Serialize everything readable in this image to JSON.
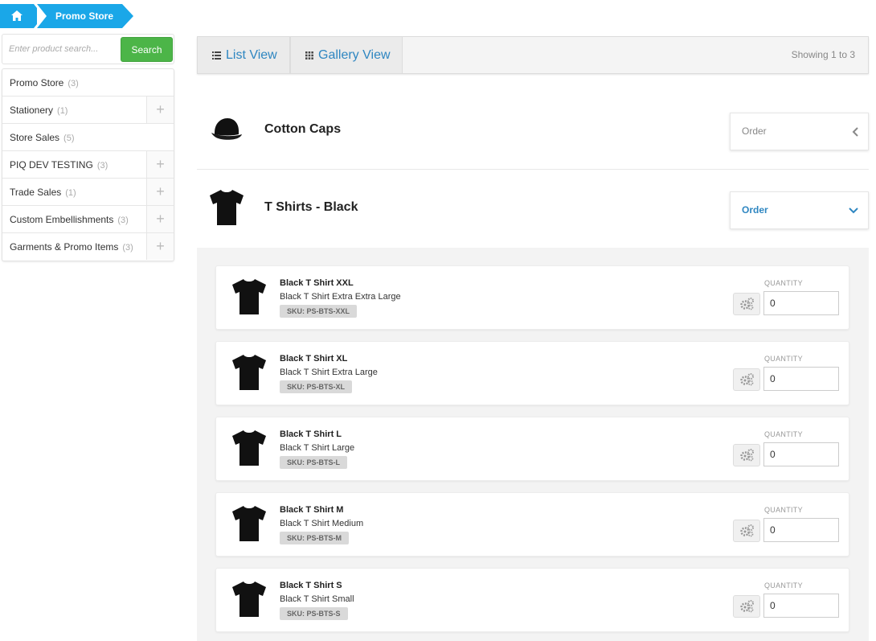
{
  "breadcrumb": {
    "current": "Promo Store"
  },
  "search": {
    "placeholder": "Enter product search...",
    "button_label": "Search"
  },
  "sidebar": {
    "items": [
      {
        "label": "Promo Store",
        "count": "(3)",
        "expandable": false
      },
      {
        "label": "Stationery",
        "count": "(1)",
        "expandable": true
      },
      {
        "label": "Store Sales",
        "count": "(5)",
        "expandable": false
      },
      {
        "label": "PIQ DEV TESTING",
        "count": "(3)",
        "expandable": true
      },
      {
        "label": "Trade Sales",
        "count": "(1)",
        "expandable": true
      },
      {
        "label": "Custom Embellishments",
        "count": "(3)",
        "expandable": true
      },
      {
        "label": "Garments & Promo Items",
        "count": "(3)",
        "expandable": true
      }
    ]
  },
  "toolbar": {
    "list_view_label": "List View",
    "gallery_view_label": "Gallery View",
    "showing_text": "Showing 1 to 3"
  },
  "products": [
    {
      "title": "Cotton Caps",
      "order_label": "Order",
      "expanded": false
    },
    {
      "title": "T Shirts - Black",
      "order_label": "Order",
      "expanded": true
    }
  ],
  "variants": [
    {
      "name": "Black T Shirt XXL",
      "desc": "Black T Shirt Extra Extra Large",
      "sku": "SKU: PS-BTS-XXL",
      "qty_label": "QUANTITY",
      "qty": "0"
    },
    {
      "name": "Black T Shirt XL",
      "desc": "Black T Shirt Extra Large",
      "sku": "SKU: PS-BTS-XL",
      "qty_label": "QUANTITY",
      "qty": "0"
    },
    {
      "name": "Black T Shirt L",
      "desc": "Black T Shirt Large",
      "sku": "SKU: PS-BTS-L",
      "qty_label": "QUANTITY",
      "qty": "0"
    },
    {
      "name": "Black T Shirt M",
      "desc": "Black T Shirt Medium",
      "sku": "SKU: PS-BTS-M",
      "qty_label": "QUANTITY",
      "qty": "0"
    },
    {
      "name": "Black T Shirt S",
      "desc": "Black T Shirt Small",
      "sku": "SKU: PS-BTS-S",
      "qty_label": "QUANTITY",
      "qty": "0"
    }
  ],
  "icons": {
    "home": "home-icon",
    "plus": "plus-icon",
    "list": "list-icon",
    "grid": "grid-icon",
    "chevron_left": "chevron-left-icon",
    "chevron_down": "chevron-down-icon",
    "gear": "gears-icon"
  },
  "colors": {
    "brand_blue": "#1aa7e8",
    "search_green": "#4cb548",
    "link_blue": "#2e86c1"
  }
}
